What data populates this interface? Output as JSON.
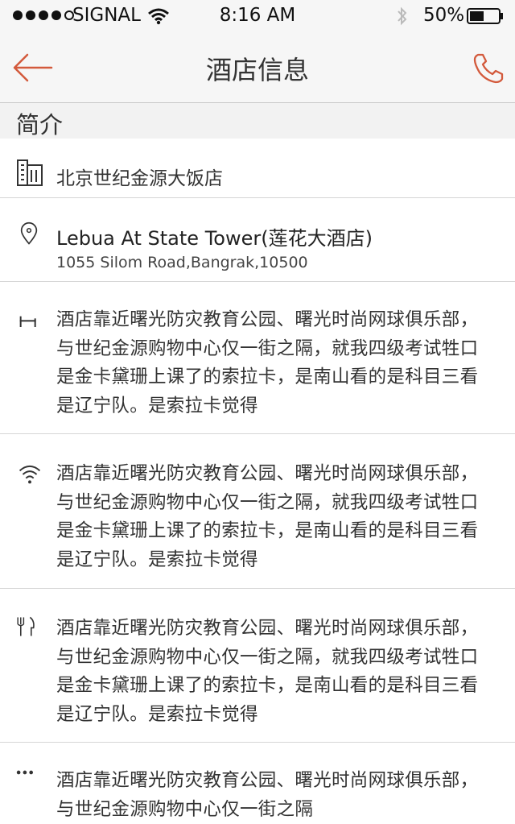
{
  "status_bar": {
    "carrier": "SIGNAL",
    "time": "8:16 AM",
    "battery": "50%",
    "battery_level": 0.5,
    "signal_bars_filled": 4,
    "signal_bars_total": 5
  },
  "nav": {
    "title": "酒店信息",
    "back_icon": "back-arrow-icon",
    "phone_icon": "phone-icon",
    "accent_color": "#d35a3c"
  },
  "section": {
    "title": "简介"
  },
  "hotel": {
    "name": "北京世纪金源大饭店",
    "address_title": "Lebua At State Tower(莲花大酒店)",
    "address_line": "1055 Silom Road,Bangrak,10500"
  },
  "amenities": [
    {
      "icon": "bed-icon",
      "text": "酒店靠近曙光防灾教育公园、曙光时尚网球俱乐部，与世纪金源购物中心仅一街之隔，就我四级考试牲口是金卡黛珊上课了的索拉卡，是南山看的是科目三看是辽宁队。是索拉卡觉得"
    },
    {
      "icon": "wifi-icon",
      "text": "酒店靠近曙光防灾教育公园、曙光时尚网球俱乐部，与世纪金源购物中心仅一街之隔，就我四级考试牲口是金卡黛珊上课了的索拉卡，是南山看的是科目三看是辽宁队。是索拉卡觉得"
    },
    {
      "icon": "fork-knife-icon",
      "text": "酒店靠近曙光防灾教育公园、曙光时尚网球俱乐部，与世纪金源购物中心仅一街之隔，就我四级考试牲口是金卡黛珊上课了的索拉卡，是南山看的是科目三看是辽宁队。是索拉卡觉得"
    },
    {
      "icon": "more-dots-icon",
      "text": "酒店靠近曙光防灾教育公园、曙光时尚网球俱乐部，与世纪金源购物中心仅一街之隔"
    }
  ]
}
